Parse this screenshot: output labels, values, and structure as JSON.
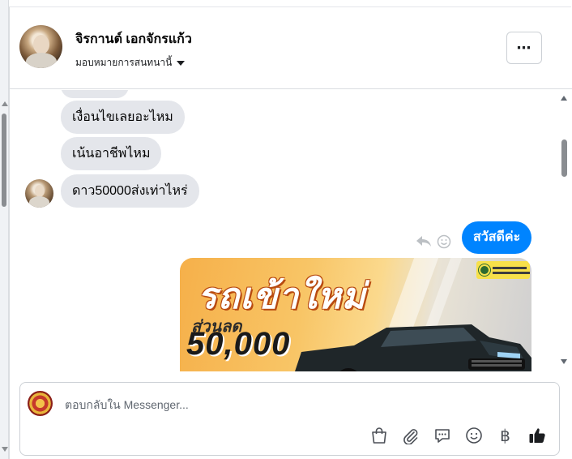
{
  "header": {
    "contact_name": "จิรกานต์ เอกจักรแก้ว",
    "assign_label": "มอบหมายการสนทนานี้"
  },
  "messages": {
    "incoming": [
      "เงื่อนไขเลยอะไหม",
      "เน้นอาชีพไหม",
      "ดาว50000ส่งเท่าไหร่"
    ],
    "outgoing": "สวัสดีค่ะ",
    "image_ad": {
      "headline": "รถเข้าใหม่",
      "discount_label": "ส่วนลด",
      "discount_amount": "50,000"
    }
  },
  "composer": {
    "placeholder": "ตอบกลับใน Messenger...",
    "tools": [
      "bag-icon",
      "paperclip-icon",
      "chat-icon",
      "emoji-icon",
      "baht-icon",
      "thumbs-up-icon"
    ],
    "baht_symbol": "฿"
  },
  "colors": {
    "outgoing_bubble": "#0084ff",
    "incoming_bubble": "#e4e6eb"
  }
}
